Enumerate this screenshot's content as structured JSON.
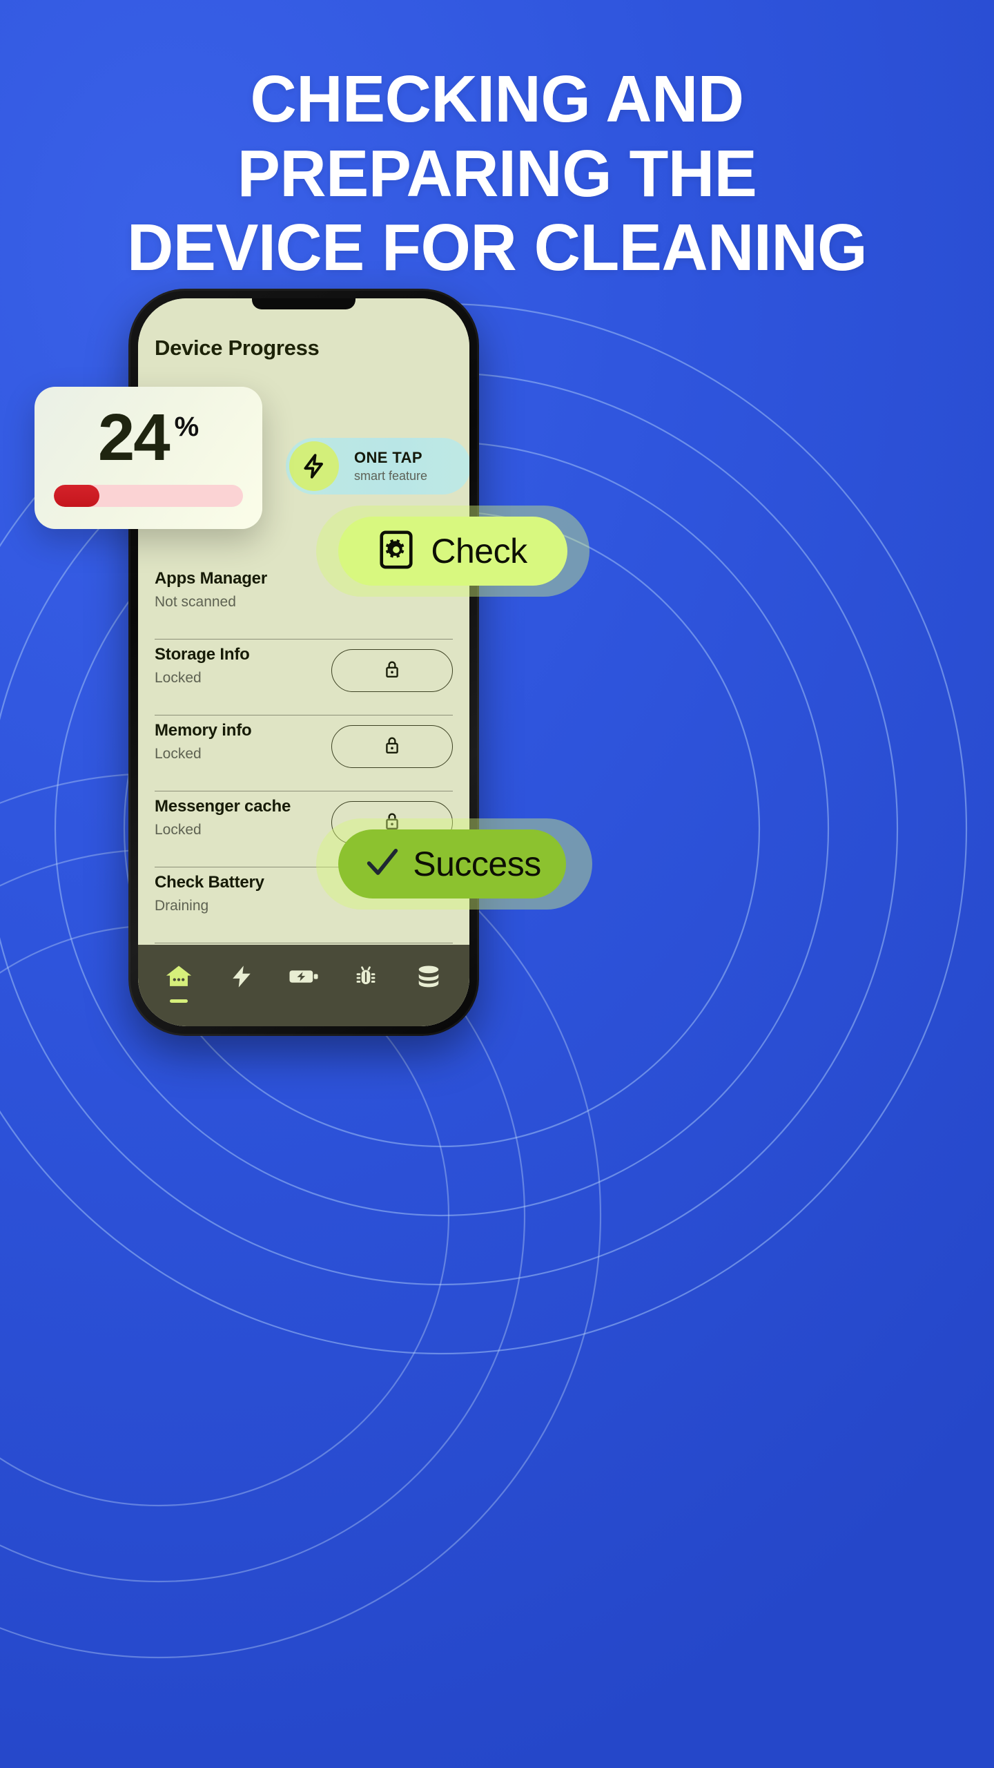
{
  "headline": {
    "line1": "CHECKING AND",
    "line2": "PREPARING THE",
    "line3": "DEVICE FOR CLEANING"
  },
  "colors": {
    "background_blue": "#2f55dd",
    "headline_white": "#ffffff",
    "phone_frame": "#0b0b0b",
    "screen_bg": "#dfe4c4",
    "accent_lime": "#d8f87f",
    "success_green": "#8cc22f",
    "progress_red": "#c9181f",
    "progress_track_pink": "#fbd3d4",
    "one_tap_bg": "#bde8e3",
    "nav_bar": "#4a4b39",
    "text_dark": "#161a07",
    "text_muted": "#5e6252"
  },
  "phone": {
    "screen_title": "Device Progress",
    "one_tap": {
      "icon": "lightning-bolt-icon",
      "title": "ONE TAP",
      "subtitle": "smart feature"
    },
    "tasks": [
      {
        "label": "Apps Manager",
        "status": "Not scanned",
        "action": "check",
        "action_icon": "gear-in-frame-icon"
      },
      {
        "label": "Storage Info",
        "status": "Locked",
        "action": "locked",
        "action_icon": "lock-icon"
      },
      {
        "label": "Memory info",
        "status": "Locked",
        "action": "locked",
        "action_icon": "lock-icon"
      },
      {
        "label": "Messenger cache",
        "status": "Locked",
        "action": "locked",
        "action_icon": "lock-icon"
      },
      {
        "label": "Check Battery",
        "status": "Draining",
        "action": "success",
        "action_icon": "check-mark-icon"
      }
    ],
    "bottom_nav": [
      {
        "icon": "home-icon",
        "active": true
      },
      {
        "icon": "lightning-bolt-icon",
        "active": false
      },
      {
        "icon": "battery-bolt-icon",
        "active": false
      },
      {
        "icon": "bug-icon",
        "active": false
      },
      {
        "icon": "database-icon",
        "active": false
      }
    ]
  },
  "overlays": {
    "progress_card": {
      "value": "24",
      "unit": "%",
      "progress_percent": 24
    },
    "check_button": {
      "label": "Check",
      "icon": "gear-in-frame-icon"
    },
    "success_button": {
      "label": "Success",
      "icon": "check-mark-icon"
    }
  }
}
